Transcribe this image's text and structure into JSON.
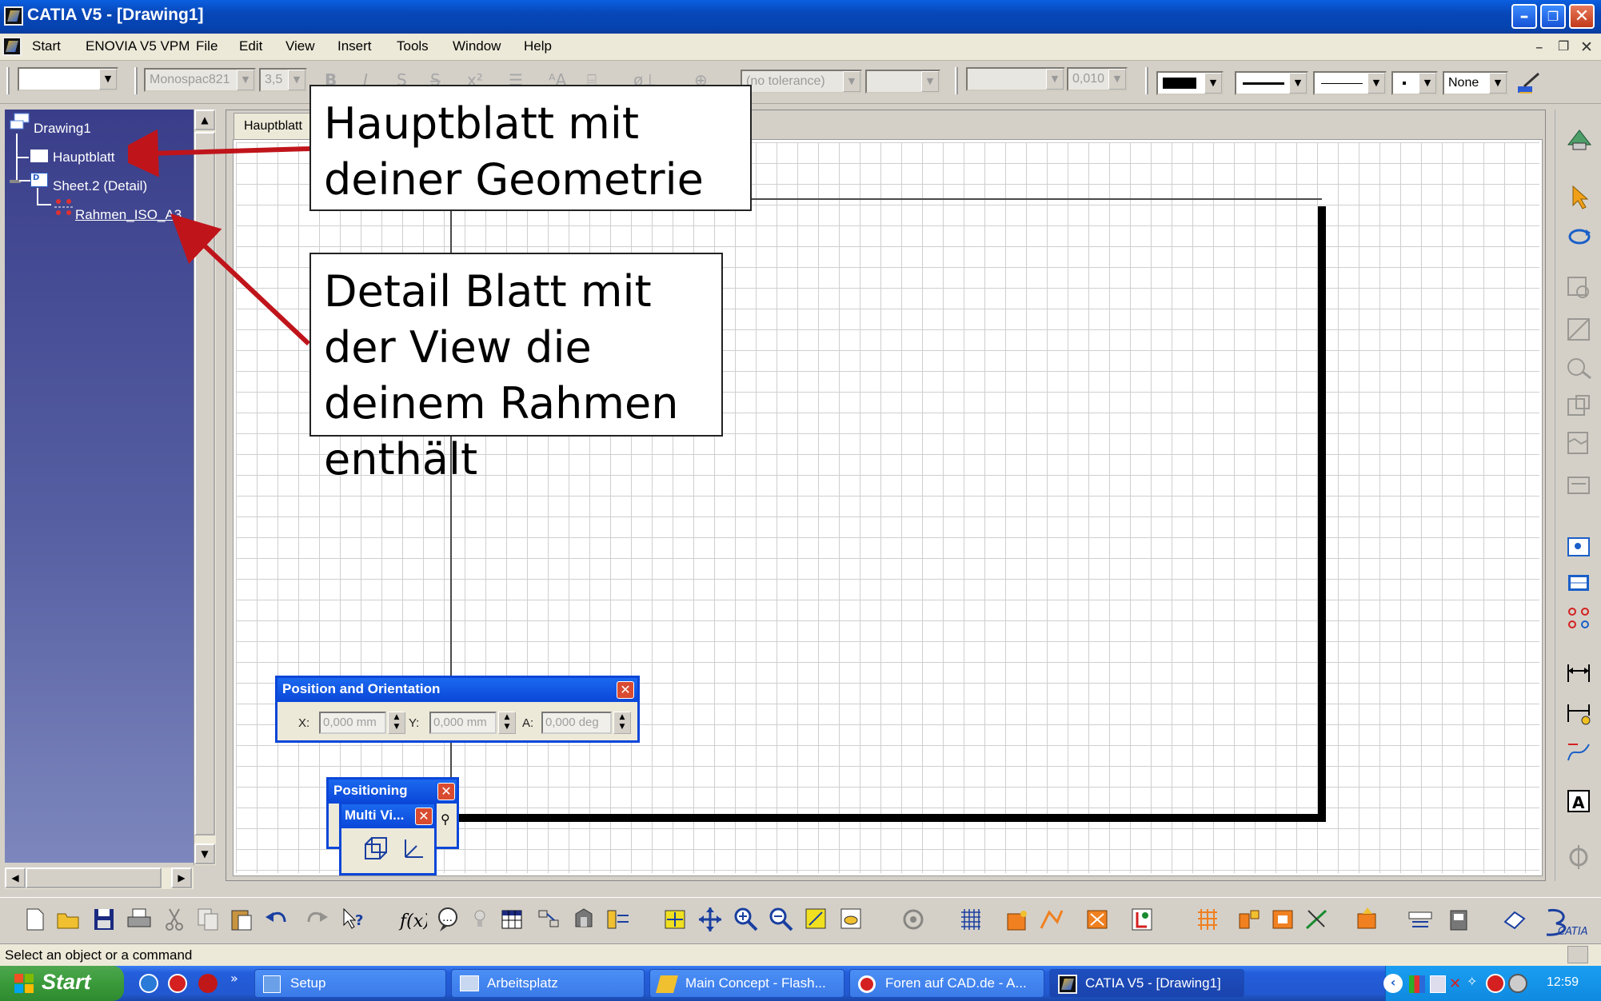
{
  "window": {
    "title": "CATIA V5 - [Drawing1]"
  },
  "menu": {
    "items": [
      {
        "label": "Start"
      },
      {
        "label": "ENOVIA V5 VPM"
      },
      {
        "label": "File"
      },
      {
        "label": "Edit"
      },
      {
        "label": "View"
      },
      {
        "label": "Insert"
      },
      {
        "label": "Tools"
      },
      {
        "label": "Window"
      },
      {
        "label": "Help"
      }
    ]
  },
  "toolbar_top": {
    "font_name": "Monospac821",
    "font_size": "3,5",
    "tolerance": "(no tolerance)",
    "precision": "0,010",
    "line_end": "None"
  },
  "tree": {
    "root": "Drawing1",
    "items": [
      {
        "label": "Hauptblatt"
      },
      {
        "label": "Sheet.2 (Detail)"
      },
      {
        "label": "Rahmen_ISO_A3"
      }
    ]
  },
  "sheet_tab": {
    "label": "Hauptblatt"
  },
  "callouts": {
    "main": "Hauptblatt mit deiner Geometrie",
    "detail": "Detail Blatt mit der View die deinem Rahmen enthält"
  },
  "position_dialog": {
    "title": "Position and Orientation",
    "x_label": "X:",
    "x_value": "0,000 mm",
    "y_label": "Y:",
    "y_value": "0,000 mm",
    "a_label": "A:",
    "a_value": "0,000 deg"
  },
  "positioning_dialog": {
    "title": "Positioning"
  },
  "multiview_dialog": {
    "title": "Multi Vi..."
  },
  "status": {
    "text": "Select an object or a command"
  },
  "taskbar": {
    "start": "Start",
    "tasks": [
      {
        "label": "Setup"
      },
      {
        "label": "Arbeitsplatz"
      },
      {
        "label": "Main Concept - Flash..."
      },
      {
        "label": "Foren auf CAD.de - A..."
      },
      {
        "label": "CATIA V5 - [Drawing1]"
      }
    ],
    "clock": "12:59"
  }
}
